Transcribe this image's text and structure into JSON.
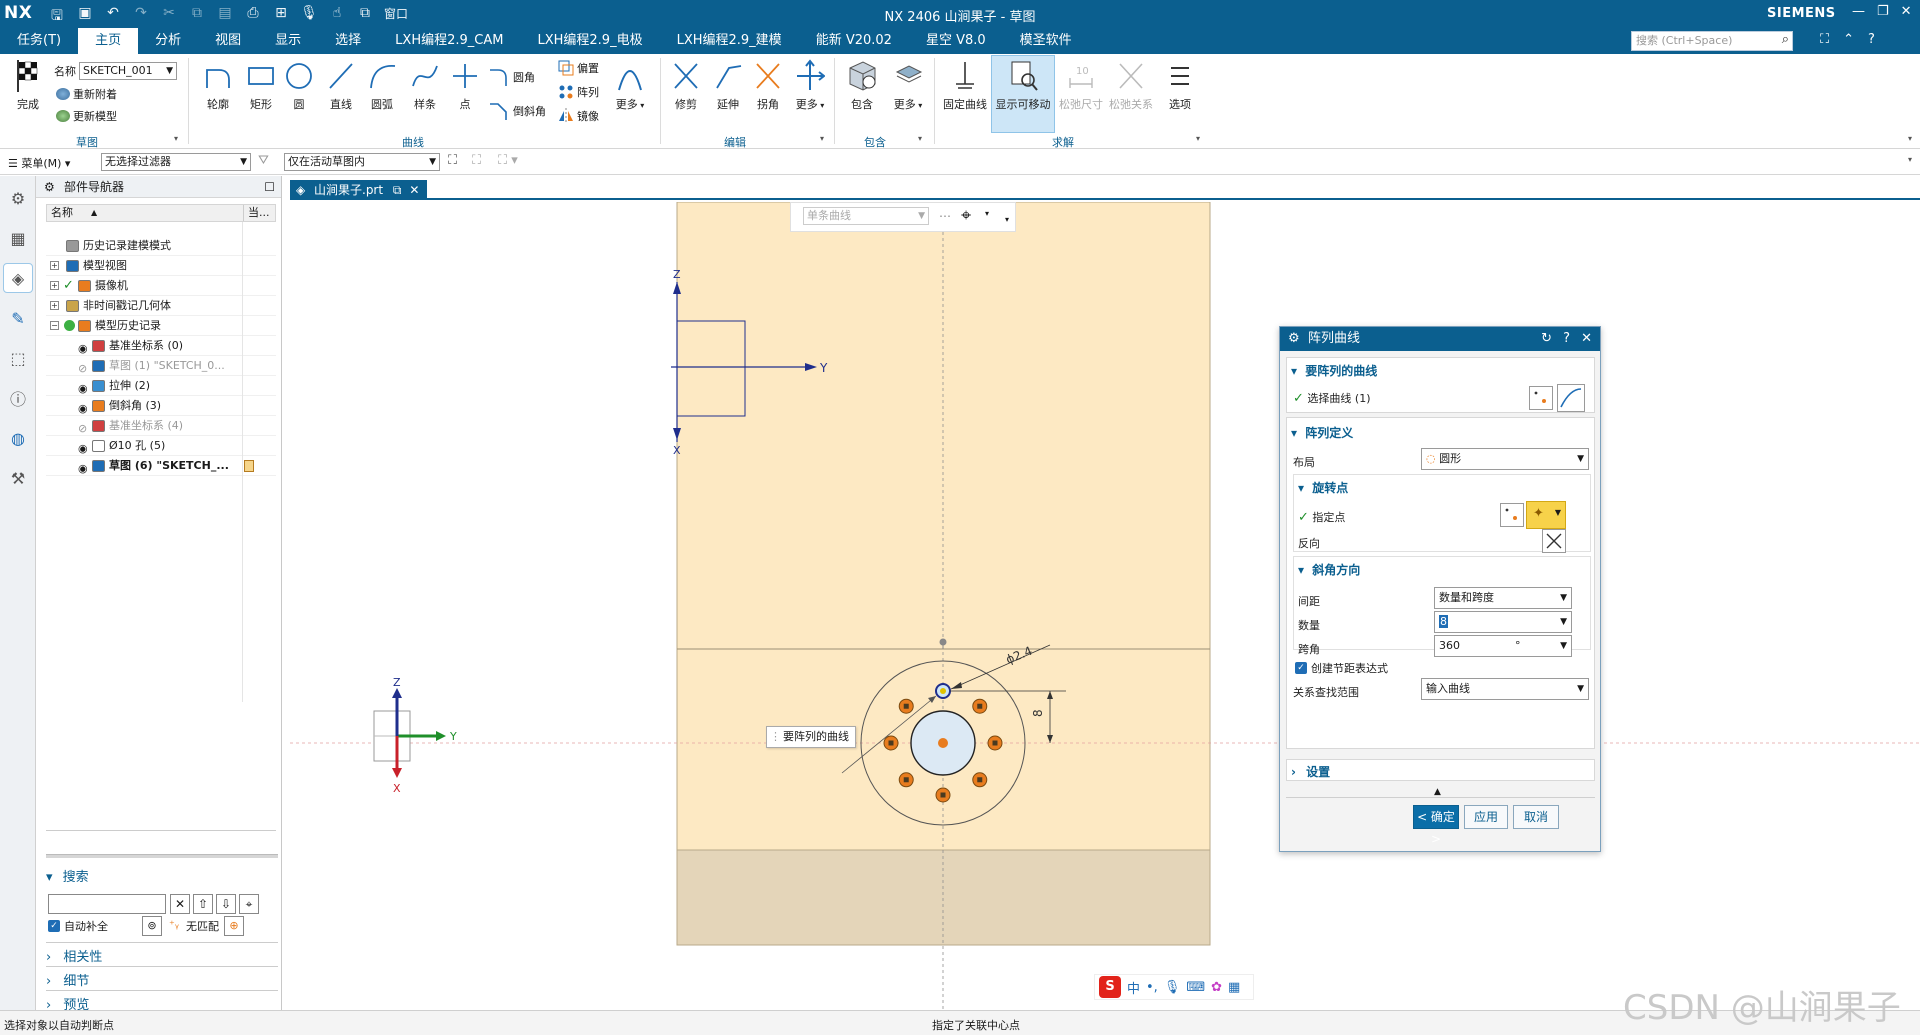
{
  "window": {
    "logo": "NX",
    "title": "NX 2406 山涧果子 - 草图",
    "brand": "SIEMENS",
    "window_menu": "窗口"
  },
  "menubar": {
    "tabs": [
      "任务(T)",
      "主页",
      "分析",
      "视图",
      "显示",
      "选择",
      "LXH编程2.9_CAM",
      "LXH编程2.9_电极",
      "LXH编程2.9_建模",
      "能新 V20.02",
      "星空 V8.0",
      "模圣软件"
    ],
    "active_tab": "主页",
    "search_placeholder": "搜索 (Ctrl+Space)"
  },
  "ribbon": {
    "finish_label": "完成",
    "name_label": "名称",
    "sketch_name": "SKETCH_001",
    "reattach_label": "重新附着",
    "update_model_label": "更新模型",
    "group_sketch": "草图",
    "curve_tools": [
      "轮廓",
      "矩形",
      "圆",
      "直线",
      "圆弧",
      "样条",
      "点"
    ],
    "fillet_label": "圆角",
    "chamfer_label": "倒斜角",
    "offset_label": "偏置",
    "pattern_label": "阵列",
    "mirror_label": "镜像",
    "more_label": "更多",
    "group_curve": "曲线",
    "edit_tools": [
      "修剪",
      "延伸",
      "拐角"
    ],
    "group_edit": "编辑",
    "include_label": "包含",
    "group_include": "包含",
    "fixed_curve_label": "固定曲线",
    "show_movable_label": "显示可移动",
    "relax_dim_label": "松弛尺寸",
    "relax_rel_label": "松弛关系",
    "options_label": "选项",
    "group_solve": "求解"
  },
  "selbar": {
    "menu_label": "菜单(M)",
    "filter": "无选择过滤器",
    "scope": "仅在活动草图内"
  },
  "navigator": {
    "title": "部件导航器",
    "col_name": "名称",
    "col_current": "当...",
    "items": [
      {
        "label": "历史记录建模模式"
      },
      {
        "label": "模型视图"
      },
      {
        "label": "摄像机"
      },
      {
        "label": "非时间戳记几何体"
      },
      {
        "label": "模型历史记录"
      },
      {
        "label": "基准坐标系 (0)"
      },
      {
        "label": "草图 (1) \"SKETCH_0..."
      },
      {
        "label": "拉伸 (2)"
      },
      {
        "label": "倒斜角 (3)"
      },
      {
        "label": "基准坐标系 (4)"
      },
      {
        "label": "Ø10 孔 (5)"
      },
      {
        "label": "草图 (6) \"SKETCH_..."
      }
    ],
    "search_label": "搜索",
    "autocomplete_label": "自动补全",
    "no_match_label": "无匹配",
    "relevance_label": "相关性",
    "details_label": "细节",
    "preview_label": "预览"
  },
  "graphics": {
    "part_tab": "山涧果子.prt",
    "curve_rule": "单条曲线",
    "tooltip": "要阵列的曲线",
    "dim_diameter": "ϕ2.4",
    "dim_linear": "8",
    "axis_y": "Y",
    "axis_x": "X",
    "axis_z": "Z"
  },
  "dialog": {
    "title": "阵列曲线",
    "sec_curves": "要阵列的曲线",
    "select_curve": "选择曲线 (1)",
    "sec_def": "阵列定义",
    "layout_label": "布局",
    "layout_value": "圆形",
    "pivot_title": "旋转点",
    "specify_point": "指定点",
    "reverse_label": "反向",
    "angle_dir_title": "斜角方向",
    "spacing_label": "间距",
    "spacing_value": "数量和跨度",
    "count_label": "数量",
    "count_value": "8",
    "span_label": "跨角",
    "span_value": "360",
    "span_unit": "°",
    "create_expr_label": "创建节距表达式",
    "relation_label": "关系查找范围",
    "relation_value": "输入曲线",
    "settings_label": "设置",
    "ok_label": "< 确定 >",
    "apply_label": "应用",
    "cancel_label": "取消"
  },
  "status": {
    "left": "选择对象以自动判断点",
    "center": "指定了关联中心点"
  },
  "ime": {
    "lang": "中"
  },
  "watermark": "CSDN @山涧果子",
  "colors": {
    "titlebar": "#0b5f8f",
    "part_face": "#fde9c3",
    "part_bottom": "#e4d5b9",
    "sketch_curve": "#1f2e8c",
    "accent_orange": "#e87c1e"
  }
}
